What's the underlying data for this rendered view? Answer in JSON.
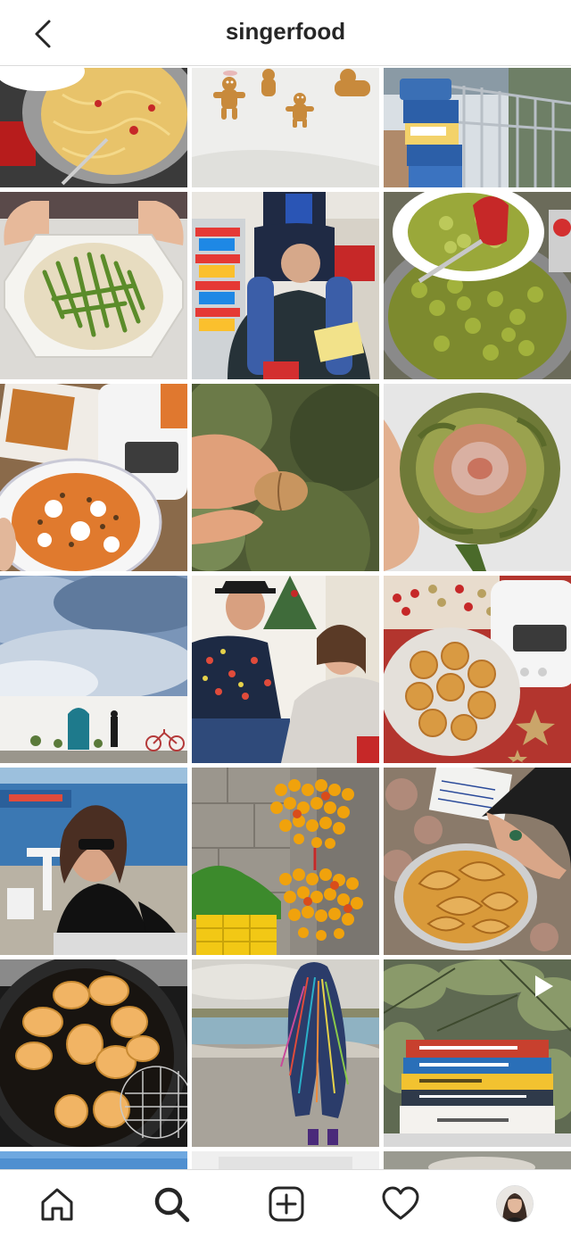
{
  "header": {
    "username": "singerfood",
    "back_icon": "chevron-left-icon"
  },
  "grid": {
    "posts": [
      {
        "subject": "spaghetti-pan",
        "icon": ""
      },
      {
        "subject": "gingerbread-cookies",
        "icon": ""
      },
      {
        "subject": "pasta-packages-balcony",
        "icon": ""
      },
      {
        "subject": "asparagus-risotto",
        "icon": ""
      },
      {
        "subject": "supermarket-shoulders",
        "icon": ""
      },
      {
        "subject": "orecchiette-pan",
        "icon": ""
      },
      {
        "subject": "cookbook-orange-risotto",
        "icon": ""
      },
      {
        "subject": "almond-in-hand",
        "icon": ""
      },
      {
        "subject": "stuffed-artichoke",
        "icon": ""
      },
      {
        "subject": "sky-white-wall",
        "icon": ""
      },
      {
        "subject": "couple-christmas",
        "icon": ""
      },
      {
        "subject": "christmas-fritters",
        "icon": ""
      },
      {
        "subject": "woman-at-seaside",
        "icon": ""
      },
      {
        "subject": "hanging-tomatoes",
        "icon": ""
      },
      {
        "subject": "fried-artichokes-tray",
        "icon": ""
      },
      {
        "subject": "frying-dough",
        "icon": ""
      },
      {
        "subject": "beach-figure",
        "icon": ""
      },
      {
        "subject": "books-stack",
        "icon": "play-icon"
      }
    ]
  },
  "tabbar": {
    "items": [
      {
        "name": "home",
        "icon": "home-icon"
      },
      {
        "name": "search",
        "icon": "search-icon"
      },
      {
        "name": "new-post",
        "icon": "plus-square-icon"
      },
      {
        "name": "activity",
        "icon": "heart-icon"
      },
      {
        "name": "profile",
        "icon": "profile-avatar"
      }
    ]
  },
  "colors": {
    "text": "#262626",
    "border": "#dbdbdb",
    "background": "#ffffff"
  }
}
